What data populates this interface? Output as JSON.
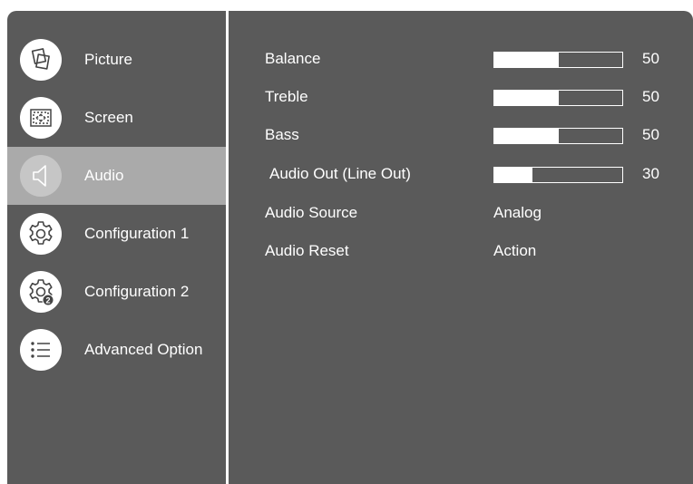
{
  "sidebar": {
    "items": [
      {
        "label": "Picture",
        "icon": "picture-icon"
      },
      {
        "label": "Screen",
        "icon": "screen-icon"
      },
      {
        "label": "Audio",
        "icon": "speaker-icon",
        "selected": true
      },
      {
        "label": "Configuration 1",
        "icon": "gear-icon"
      },
      {
        "label": "Configuration 2",
        "icon": "gear-2-icon",
        "badge": "2"
      },
      {
        "label": "Advanced Option",
        "icon": "list-icon"
      }
    ]
  },
  "audio": {
    "settings": [
      {
        "label": "Balance",
        "value": "50",
        "level": 0.5
      },
      {
        "label": "Treble",
        "value": "50",
        "level": 0.5
      },
      {
        "label": "Bass",
        "value": "50",
        "level": 0.5
      },
      {
        "label": "Audio Out (Line Out)",
        "value": "30",
        "level": 0.3
      },
      {
        "label": "Audio Source",
        "option": "Analog"
      },
      {
        "label": "Audio Reset",
        "option": "Action"
      }
    ]
  },
  "colors": {
    "panel": "#5a5a5a",
    "selected": "#aaaaaa",
    "text": "#ffffff",
    "icon_bg": "#ffffff",
    "icon_fg": "#444444"
  }
}
